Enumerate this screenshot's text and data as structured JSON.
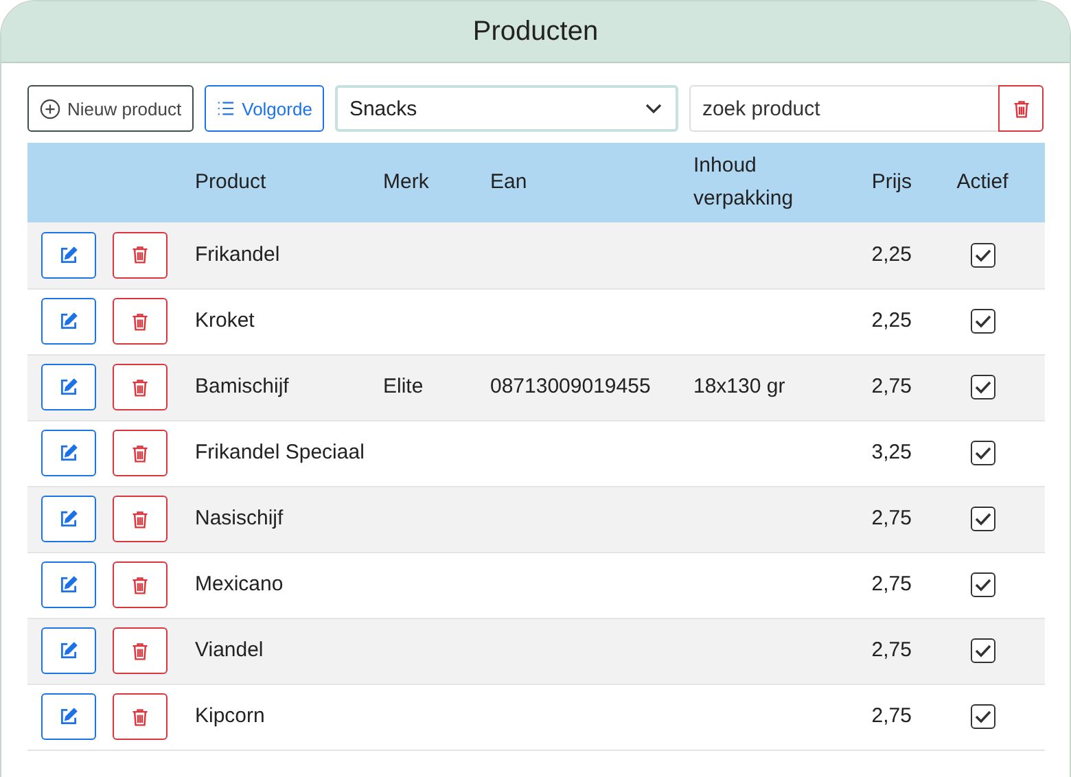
{
  "window": {
    "title": "Producten"
  },
  "toolbar": {
    "new_button": "Nieuw product",
    "order_button": "Volgorde",
    "category": "Snacks",
    "search": {
      "placeholder": "zoek product"
    }
  },
  "table": {
    "columns": [
      "Product",
      "Merk",
      "Ean",
      "Inhoud verpakking",
      "Prijs",
      "Actief"
    ],
    "rows": [
      {
        "product": "Frikandel",
        "price": "2,25",
        "active": true
      },
      {
        "product": "Kroket",
        "price": "2,25",
        "active": true
      },
      {
        "product": "Bamischijf",
        "brand": "Elite",
        "ean": "08713009019455",
        "content": "18x130 gr",
        "price": "2,75",
        "active": true
      },
      {
        "product": "Frikandel Speciaal",
        "price": "3,25",
        "active": true
      },
      {
        "product": "Nasischijf",
        "price": "2,75",
        "active": true
      },
      {
        "product": "Mexicano",
        "price": "2,75",
        "active": true
      },
      {
        "product": "Viandel",
        "price": "2,75",
        "active": true
      },
      {
        "product": "Kipcorn",
        "price": "2,75",
        "active": true
      }
    ]
  }
}
